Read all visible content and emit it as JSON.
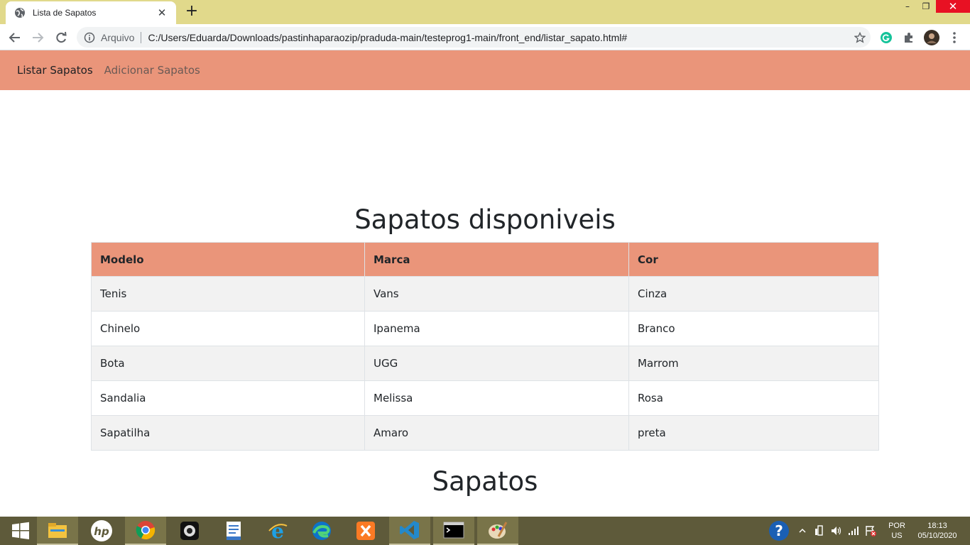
{
  "browser": {
    "tab_title": "Lista de Sapatos",
    "close_tab_label": "✕",
    "new_tab_label": "+",
    "scheme_label": "Arquivo",
    "url": "C:/Users/Eduarda/Downloads/pastinhaparaozip/praduda-main/testeprog1-main/front_end/listar_sapato.html#",
    "window_controls": {
      "minimize": "–",
      "maximize": "❐",
      "close": "✕"
    }
  },
  "navbar": {
    "items": [
      {
        "label": "Listar Sapatos"
      },
      {
        "label": "Adicionar Sapatos"
      }
    ]
  },
  "main": {
    "heading": "Sapatos disponiveis",
    "table": {
      "headers": [
        "Modelo",
        "Marca",
        "Cor"
      ],
      "rows": [
        [
          "Tenis",
          "Vans",
          "Cinza"
        ],
        [
          "Chinelo",
          "Ipanema",
          "Branco"
        ],
        [
          "Bota",
          "UGG",
          "Marrom"
        ],
        [
          "Sandalia",
          "Melissa",
          "Rosa"
        ],
        [
          "Sapatilha",
          "Amaro",
          "preta"
        ]
      ]
    },
    "second_heading": "Sapatos"
  },
  "taskbar": {
    "apps": [
      "file-explorer-icon",
      "hp-icon",
      "chrome-icon",
      "webcam-icon",
      "wordpad-icon",
      "ie-icon",
      "edge-icon",
      "xampp-icon",
      "vscode-icon",
      "cmd-icon",
      "paint-icon"
    ],
    "lang_line1": "POR",
    "lang_line2": "US",
    "time": "18:13",
    "date": "05/10/2020"
  },
  "colors": {
    "tabstrip": "#e1d98b",
    "navbar": "#ea957a",
    "table_header": "#ea957a",
    "taskbar": "#5e5a3a"
  }
}
